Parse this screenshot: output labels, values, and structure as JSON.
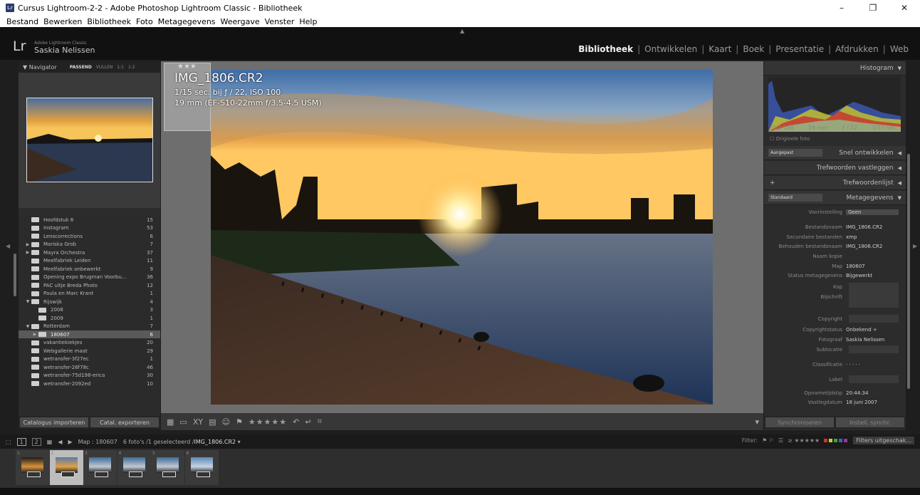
{
  "window": {
    "title": "Cursus Lightroom-2-2 - Adobe Photoshop Lightroom Classic - Bibliotheek",
    "app_icon": "Lr",
    "minimize": "–",
    "maximize": "❐",
    "close": "✕"
  },
  "menu": [
    "Bestand",
    "Bewerken",
    "Bibliotheek",
    "Foto",
    "Metagegevens",
    "Weergave",
    "Venster",
    "Help"
  ],
  "identity": {
    "logo": "Lr",
    "app": "Adobe Lightroom Classic",
    "user": "Saskia Nelissen"
  },
  "modules": [
    "Bibliotheek",
    "Ontwikkelen",
    "Kaart",
    "Boek",
    "Presentatie",
    "Afdrukken",
    "Web"
  ],
  "navigator": {
    "title": "Navigator",
    "options": [
      "PASSEND",
      "VULLEN",
      "1:1",
      "1:2"
    ]
  },
  "folders": [
    {
      "arrow": "",
      "name": "Hoofdstuk 6",
      "count": "15"
    },
    {
      "arrow": "",
      "name": "Instagram",
      "count": "53"
    },
    {
      "arrow": "",
      "name": "Lenscorrections",
      "count": "6"
    },
    {
      "arrow": "▶",
      "name": "Mariska Grob",
      "count": "7"
    },
    {
      "arrow": "▶",
      "name": "Mayra Orchestra",
      "count": "37"
    },
    {
      "arrow": "",
      "name": "Meelfabriek Leiden",
      "count": "11"
    },
    {
      "arrow": "",
      "name": "Meelfabriek onbewerkt",
      "count": "9"
    },
    {
      "arrow": "",
      "name": "Opening expo Brugman Voorbu...",
      "count": "36"
    },
    {
      "arrow": "",
      "name": "PAC uitje Breda Photo",
      "count": "12"
    },
    {
      "arrow": "",
      "name": "Paula en Marc Krant",
      "count": "1"
    },
    {
      "arrow": "▼",
      "name": "Rijswijk",
      "count": "4"
    },
    {
      "arrow": "",
      "name": "2008",
      "count": "3",
      "indent": true
    },
    {
      "arrow": "",
      "name": "2009",
      "count": "1",
      "indent": true
    },
    {
      "arrow": "▼",
      "name": "Rotterdam",
      "count": "7"
    },
    {
      "arrow": "▶",
      "name": "180607",
      "count": "6",
      "indent": true,
      "selected": true
    },
    {
      "arrow": "",
      "name": "vakantiekiekjes",
      "count": "20"
    },
    {
      "arrow": "",
      "name": "Webgallerie maat",
      "count": "29"
    },
    {
      "arrow": "",
      "name": "wetransfer-3f27ec",
      "count": "1"
    },
    {
      "arrow": "",
      "name": "wetransfer-26f78c",
      "count": "46"
    },
    {
      "arrow": "",
      "name": "wetransfer-75d198-erica",
      "count": "30"
    },
    {
      "arrow": "",
      "name": "wetransfer-2092ed",
      "count": "10"
    }
  ],
  "left_buttons": {
    "import": "Catalogus importeren",
    "export": "Catal. exporteren"
  },
  "photo_info": {
    "filename": "IMG_1806.CR2",
    "line1": "1/15 sec. bij ƒ / 22, ISO 100",
    "line2": "19 mm (EF-S10-22mm f/3.5-4.5 USM)"
  },
  "toolbar": {
    "stars": "★★★★★"
  },
  "right": {
    "histogram": "Histogram",
    "histo_info": [
      "ISO 100",
      "19 mm",
      "ƒ / 22",
      "1/15 sec."
    ],
    "orig": "Originele foto",
    "snel_preset": "Aangepast",
    "snel": "Snel ontwikkelen",
    "trefwoorden": "Trefwoorden vastleggen",
    "trefwoordenlijst": "Trefwoordenlijst",
    "plus": "+",
    "meta_preset": "Standaard",
    "metagegevens": "Metagegevens",
    "voorinstelling_label": "Voorinstelling",
    "voorinstelling_value": "Geen",
    "rows": [
      {
        "label": "Bestandsnaam",
        "value": "IMG_1806.CR2"
      },
      {
        "label": "Secundaire bestanden",
        "value": "xmp"
      },
      {
        "label": "Behouden bestandsnaam",
        "value": "IMG_1806.CR2"
      },
      {
        "label": "Naam kopie",
        "value": ""
      },
      {
        "label": "Map",
        "value": "180607"
      },
      {
        "label": "Status metagegevens",
        "value": "Bijgewerkt"
      }
    ],
    "kop": "Kop",
    "bijschrift": "Bijschrift",
    "copyright": "Copyright",
    "copyrightstatus_label": "Copyrightstatus",
    "copyrightstatus_value": "Onbekend ÷",
    "fotograaf_label": "Fotograaf",
    "fotograaf_value": "Saskia Nelissen",
    "sublocatie": "Sublocatie",
    "classificatie_label": "Classificatie",
    "classificatie_value": "· · · · ·",
    "label": "Label",
    "opname_label": "Opnametijdstip",
    "opname_value": "20:44:34",
    "vastleg_label": "Vastlegdatum",
    "vastleg_value": "18 juni 2007",
    "sync": "Synchroniseren",
    "sync_settings": "Instell. synchr."
  },
  "filmstrip_bar": {
    "page1": "1",
    "page2": "2",
    "source": "Map : 180607",
    "selection": "6 foto's /1 geselecteerd /",
    "filename": "IMG_1806.CR2",
    "filter": "Filter:",
    "filter_stars": "≥ ★★★★★",
    "filters_off": "Filters uitgeschak..."
  },
  "filmstrip": [
    "1",
    "2",
    "3",
    "4",
    "5",
    "6"
  ],
  "colors": {
    "accent": "#ffffff",
    "bg": "#1f1f1f",
    "panel": "#2c2c2c"
  }
}
